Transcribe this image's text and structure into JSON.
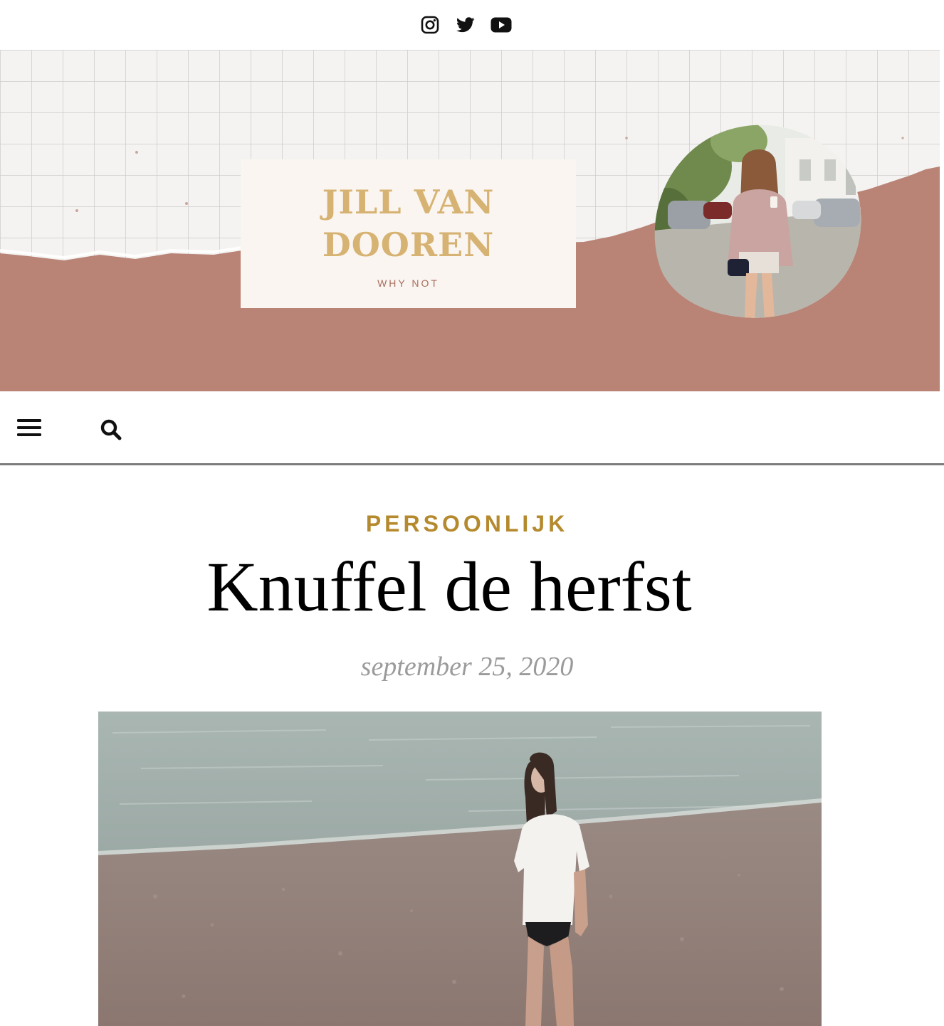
{
  "social": {
    "items": [
      {
        "name": "instagram-icon"
      },
      {
        "name": "twitter-icon"
      },
      {
        "name": "youtube-icon"
      }
    ]
  },
  "header": {
    "logo_title": "JILL VAN DOOREN",
    "logo_tagline": "WHY NOT",
    "colors": {
      "accent_rose": "#b98376",
      "logo_gold": "#d7b373",
      "logo_card": "#faf5f0"
    }
  },
  "nav": {
    "menu_icon": "hamburger-menu-icon",
    "search_icon": "search-icon"
  },
  "post": {
    "category": "PERSOONLIJK",
    "title": "Knuffel de herfst",
    "date": "september 25, 2020",
    "colors": {
      "category": "#b58a2e",
      "date": "#9b9b9b"
    }
  }
}
